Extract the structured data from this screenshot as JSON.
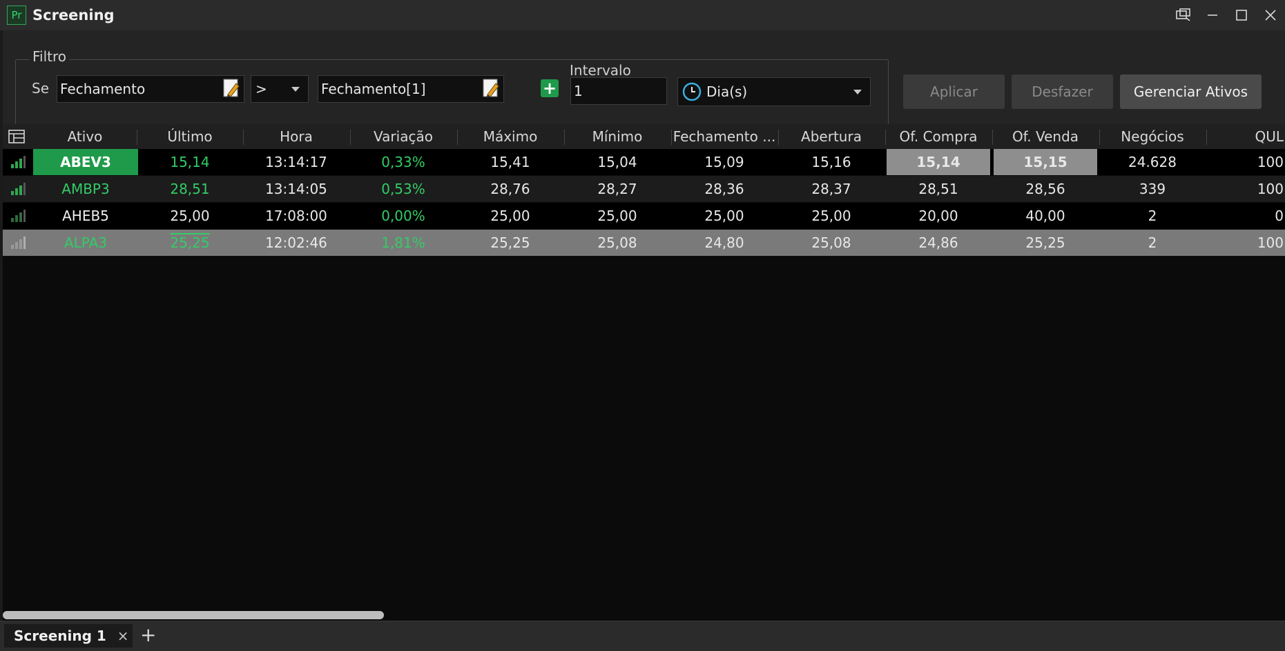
{
  "window": {
    "logo_text": "Pr",
    "title": "Screening"
  },
  "filter": {
    "legend": "Filtro",
    "se_label": "Se",
    "field1": "Fechamento",
    "operator": ">",
    "field2": "Fechamento[1]",
    "interval_label": "Intervalo",
    "interval_value": "1",
    "period": "Dia(s)"
  },
  "buttons": {
    "apply": "Aplicar",
    "undo": "Desfazer",
    "manage": "Gerenciar Ativos"
  },
  "columns": [
    "Ativo",
    "Último",
    "Hora",
    "Variação",
    "Máximo",
    "Mínimo",
    "Fechamento ...",
    "Abertura",
    "Of. Compra",
    "Of. Venda",
    "Negócios",
    "QUL"
  ],
  "rows": [
    {
      "ativo": "ABEV3",
      "ultimo": "15,14",
      "hora": "13:14:17",
      "variacao": "0,33%",
      "maximo": "15,41",
      "minimo": "15,04",
      "fechamento": "15,09",
      "abertura": "15,16",
      "of_compra": "15,14",
      "of_venda": "15,15",
      "negocios": "24.628",
      "qul": "100"
    },
    {
      "ativo": "AMBP3",
      "ultimo": "28,51",
      "hora": "13:14:05",
      "variacao": "0,53%",
      "maximo": "28,76",
      "minimo": "28,27",
      "fechamento": "28,36",
      "abertura": "28,37",
      "of_compra": "28,51",
      "of_venda": "28,56",
      "negocios": "339",
      "qul": "100"
    },
    {
      "ativo": "AHEB5",
      "ultimo": "25,00",
      "hora": "17:08:00",
      "variacao": "0,00%",
      "maximo": "25,00",
      "minimo": "25,00",
      "fechamento": "25,00",
      "abertura": "25,00",
      "of_compra": "20,00",
      "of_venda": "40,00",
      "negocios": "2",
      "qul": "0"
    },
    {
      "ativo": "ALPA3",
      "ultimo": "25,25",
      "hora": "12:02:46",
      "variacao": "1,81%",
      "maximo": "25,25",
      "minimo": "25,08",
      "fechamento": "24,80",
      "abertura": "25,08",
      "of_compra": "24,86",
      "of_venda": "25,25",
      "negocios": "2",
      "qul": "100"
    }
  ],
  "tabs": [
    {
      "label": "Screening 1",
      "close": "×"
    }
  ],
  "add_tab": "+",
  "colors": {
    "positive": "#33cc66",
    "highlight_cell": "#1f9a4a",
    "selected_row": "#7a7a7a",
    "offer_highlight": "#8e8e8e"
  }
}
